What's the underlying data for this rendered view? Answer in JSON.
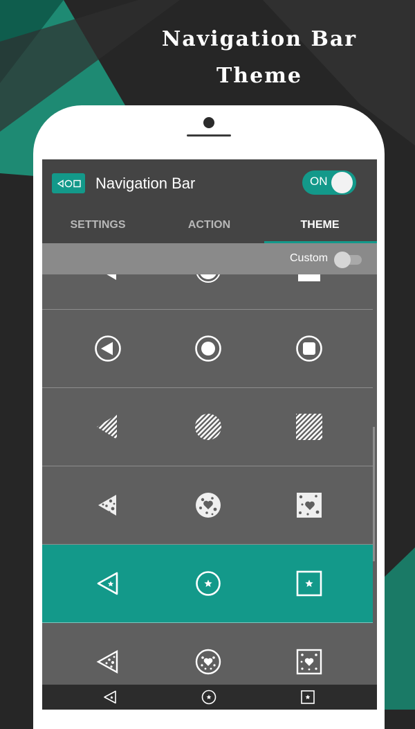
{
  "promo": {
    "title_line1": "Navigation Bar",
    "title_line2": "Theme"
  },
  "colors": {
    "accent": "#13998a",
    "background": "#262626",
    "appbar": "#444444",
    "list": "#5f5f5f"
  },
  "app": {
    "title": "Navigation Bar",
    "logo_icon": "navigation-buttons-icon",
    "master_switch": {
      "label": "ON",
      "state": "on"
    }
  },
  "tabs": [
    {
      "label": "SETTINGS",
      "active": false
    },
    {
      "label": "ACTION",
      "active": false
    },
    {
      "label": "THEME",
      "active": true
    }
  ],
  "custom": {
    "label": "Custom",
    "state": "off"
  },
  "themes": [
    {
      "name": "solid",
      "icons": [
        "back-solid-icon",
        "home-solid-icon",
        "recents-solid-icon"
      ],
      "selected": false
    },
    {
      "name": "circled",
      "icons": [
        "back-circled-icon",
        "home-circled-icon",
        "recents-circled-icon"
      ],
      "selected": false
    },
    {
      "name": "striped",
      "icons": [
        "back-striped-icon",
        "home-striped-icon",
        "recents-striped-icon"
      ],
      "selected": false
    },
    {
      "name": "hearts",
      "icons": [
        "back-hearts-icon",
        "home-hearts-icon",
        "recents-hearts-icon"
      ],
      "selected": false
    },
    {
      "name": "star-outline",
      "icons": [
        "back-star-icon",
        "home-star-icon",
        "recents-star-icon"
      ],
      "selected": true
    },
    {
      "name": "hearts-outline",
      "icons": [
        "back-hearts-outline-icon",
        "home-hearts-outline-icon",
        "recents-hearts-outline-icon"
      ],
      "selected": false
    }
  ],
  "navbar": {
    "icons": [
      "back-star-icon",
      "home-star-icon",
      "recents-star-icon"
    ]
  }
}
